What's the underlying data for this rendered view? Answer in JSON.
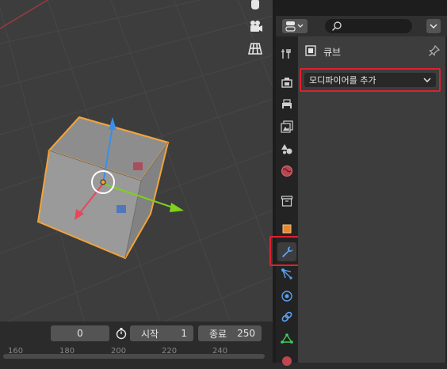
{
  "timeline": {
    "current_frame": "0",
    "start_label": "시작",
    "start_value": "1",
    "end_label": "종료",
    "end_value": "250",
    "ruler_ticks": [
      "160",
      "180",
      "200",
      "220",
      "240"
    ]
  },
  "properties": {
    "search_placeholder": "",
    "object_name": "큐브",
    "add_modifier_label": "모디파이어를 추가"
  },
  "icons": {
    "viewport": [
      "camera-view-icon",
      "grid-view-icon",
      "hand-pan-icon"
    ],
    "tabs": [
      "tool-icon",
      "render-icon",
      "output-icon",
      "view-layer-icon",
      "scene-icon",
      "world-icon",
      "collection-icon",
      "object-icon",
      "modifier-wrench-icon",
      "particles-icon",
      "physics-icon",
      "constraints-icon",
      "data-icon",
      "material-icon"
    ]
  },
  "colors": {
    "highlight": "#e0202e",
    "selection_outline": "#f2a33a",
    "axis_x": "#e8475a",
    "axis_y": "#7fd11b",
    "axis_z": "#3b8ee8"
  }
}
